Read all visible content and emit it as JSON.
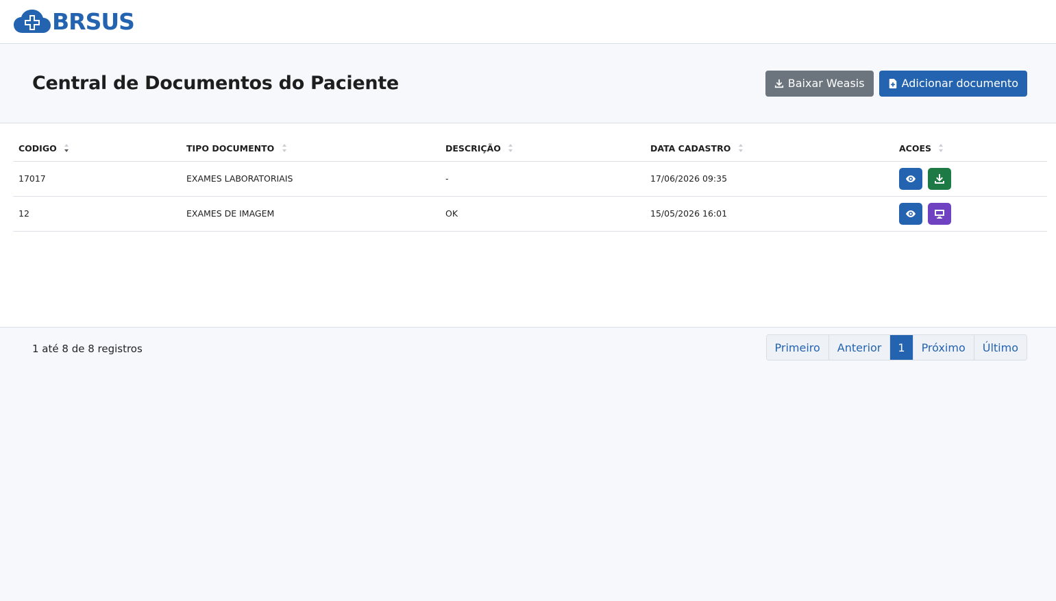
{
  "brand": {
    "name": "BRSUS",
    "color": "#2463b0",
    "icon": "medical-cross-cloud-icon"
  },
  "header": {
    "title": "Central de Documentos do Paciente",
    "buttons": {
      "weasis": {
        "label": "Baixar Weasis",
        "icon": "download-icon",
        "color": "#6c757d"
      },
      "add_document": {
        "label": "Adicionar documento",
        "icon": "file-plus-icon",
        "color": "#2463b0"
      }
    }
  },
  "table": {
    "columns": {
      "codigo": "CODIGO",
      "tipo": "TIPO DOCUMENTO",
      "descricao": "DESCRIÇÃO",
      "data": "DATA CADASTRO",
      "acoes": "ACOES"
    },
    "sorted_column": "codigo",
    "sort_direction": "desc",
    "rows": [
      {
        "codigo": "17017",
        "tipo": "EXAMES LABORATORIAIS",
        "descricao": "-",
        "data": "17/06/2026 09:35",
        "actions": [
          "view-eye-icon",
          "download-icon"
        ]
      },
      {
        "codigo": "12",
        "tipo": "EXAMES DE IMAGEM",
        "descricao": "OK",
        "data": "15/05/2026 16:01",
        "actions": [
          "view-eye-icon",
          "monitor-icon"
        ]
      }
    ]
  },
  "footer": {
    "records_info": "1 até 8 de 8 registros",
    "pagination": {
      "first": "Primeiro",
      "previous": "Anterior",
      "current": "1",
      "next": "Próximo",
      "last": "Último"
    }
  },
  "colors": {
    "primary": "#2463b0",
    "success": "#1d7a45",
    "purple": "#6f42c1",
    "secondary": "#6c757d",
    "background": "#f6f8fb"
  }
}
